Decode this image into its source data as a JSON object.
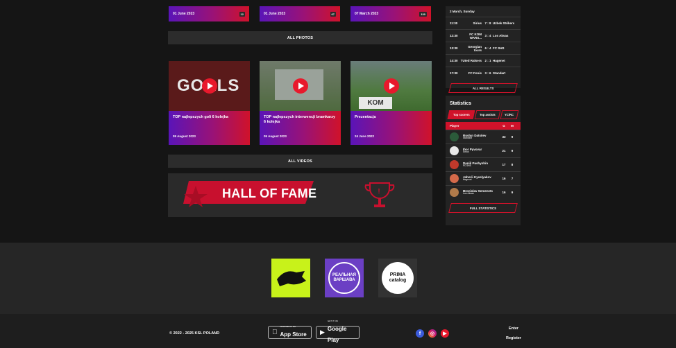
{
  "photos": [
    {
      "date": "01 June 2023",
      "count": "12"
    },
    {
      "date": "01 June 2023",
      "count": "67"
    },
    {
      "date": "07 March 2023",
      "count": "130"
    }
  ],
  "all_photos": "ALL PHOTOS",
  "videos": [
    {
      "title": "TOP najlepszych goli 6 kolejka",
      "date": "09 August 2023",
      "thumb_text": "GOALS"
    },
    {
      "title": "TOP najlepszych interwencji bramkarzy 6 kolejka",
      "date": "05 August 2023",
      "thumb_text": ""
    },
    {
      "title": "Prezentacja",
      "date": "24 June 2022",
      "thumb_text": "KOM"
    }
  ],
  "all_videos": "ALL VIDEOS",
  "hall_of_fame": "HALL OF FAME",
  "results": {
    "date": "2 March, Sunday",
    "rows": [
      {
        "time": "11:30",
        "home": "Sirius",
        "score": "7 : 8",
        "away": "Uzbek Strikers"
      },
      {
        "time": "12:30",
        "home": "FC KOM WARS...",
        "score": "3 : 4",
        "away": "Los Akvas"
      },
      {
        "time": "13:30",
        "home": "Georgian tours",
        "score": "6 : 4",
        "away": "FC SHS"
      },
      {
        "time": "14:30",
        "home": "TUted Ralsers",
        "score": "2 : 1",
        "away": "Hagenet"
      },
      {
        "time": "17:30",
        "home": "FC Fonis",
        "score": "3 : 6",
        "away": "Standart"
      }
    ],
    "all_results": "ALL RESULTS"
  },
  "statistics": {
    "title": "Statistics",
    "tabs": [
      "Top scorers",
      "Top assists",
      "YC/RC"
    ],
    "header": {
      "player": "Player",
      "c1": "G",
      "c2": "M"
    },
    "rows": [
      {
        "name": "Ruslan Datsiiev",
        "team": "Standart",
        "g": "33",
        "m": "9",
        "color": "#2b5a3a"
      },
      {
        "name": "Ihor Pyvovar",
        "team": "Sirius",
        "g": "21",
        "m": "9",
        "color": "#e8e8e8"
      },
      {
        "name": "Daniil Pashyshin",
        "team": "FC SHS",
        "g": "17",
        "m": "8",
        "color": "#c0392b"
      },
      {
        "name": "Jahorii Kyselyakov",
        "team": "Hagenet",
        "g": "16",
        "m": "7",
        "color": "#d46a4a"
      },
      {
        "name": "Bronislav Semenets",
        "team": "Los Akvas",
        "g": "16",
        "m": "9",
        "color": "#b07a4a"
      }
    ],
    "full": "FULL STATISTICS"
  },
  "partners": [
    "PRIMA catalog",
    "РЕАЛЬНАЯ ВАРШАВА"
  ],
  "footer": {
    "copyright": "© 2022 - 2025 KSL POLAND",
    "app_store_small": "Download on the",
    "app_store": "App Store",
    "google_small": "GET IT ON",
    "google": "Google Play",
    "enter": "Enter",
    "register": "Register"
  },
  "colors": {
    "accent": "#d0122a",
    "purple": "#5a14b8"
  }
}
